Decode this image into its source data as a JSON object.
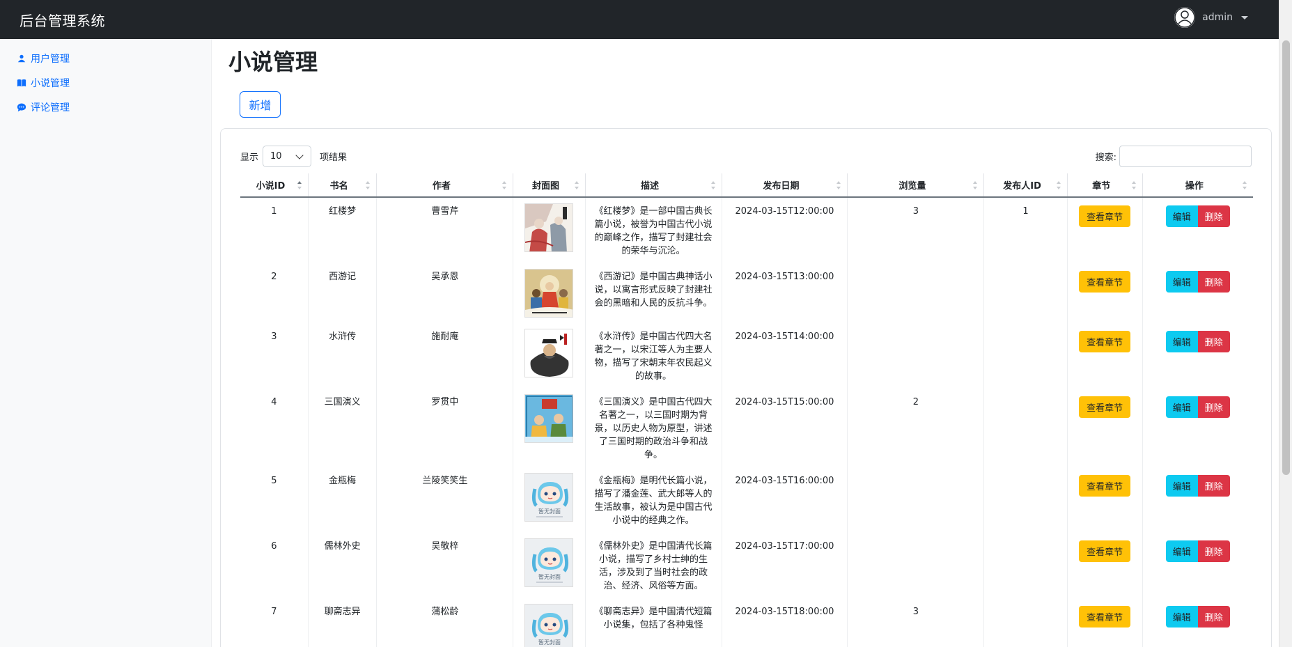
{
  "app": {
    "title": "后台管理系统",
    "user": "admin"
  },
  "sidebar": {
    "items": [
      {
        "label": "用户管理",
        "icon": "user-icon"
      },
      {
        "label": "小说管理",
        "icon": "book-icon"
      },
      {
        "label": "评论管理",
        "icon": "comment-icon"
      }
    ]
  },
  "page": {
    "title": "小说管理",
    "add_label": "新增"
  },
  "table": {
    "show_label": "显示",
    "length_value": "10",
    "results_label": "项结果",
    "search_label": "搜索:",
    "search_value": "",
    "columns": [
      "小说ID",
      "书名",
      "作者",
      "封面图",
      "描述",
      "发布日期",
      "浏览量",
      "发布人ID",
      "章节",
      "操作"
    ],
    "chapter_button": "查看章节",
    "edit_button": "编辑",
    "delete_button": "删除",
    "rows": [
      {
        "id": "1",
        "name": "红楼梦",
        "author": "曹雪芹",
        "cover": "cover-hongloumeng",
        "desc": "《红楼梦》是一部中国古典长篇小说，被誉为中国古代小说的巅峰之作，描写了封建社会的荣华与沉沦。",
        "date": "2024-03-15T12:00:00",
        "views": "3",
        "publisher": "1"
      },
      {
        "id": "2",
        "name": "西游记",
        "author": "吴承恩",
        "cover": "cover-xiyouji",
        "desc": "《西游记》是中国古典神话小说，以寓言形式反映了封建社会的黑暗和人民的反抗斗争。",
        "date": "2024-03-15T13:00:00",
        "views": "",
        "publisher": ""
      },
      {
        "id": "3",
        "name": "水浒传",
        "author": "施耐庵",
        "cover": "cover-shuihuzhuan",
        "desc": "《水浒传》是中国古代四大名著之一，以宋江等人为主要人物，描写了宋朝末年农民起义的故事。",
        "date": "2024-03-15T14:00:00",
        "views": "",
        "publisher": ""
      },
      {
        "id": "4",
        "name": "三国演义",
        "author": "罗贯中",
        "cover": "cover-sanguo",
        "desc": "《三国演义》是中国古代四大名著之一，以三国时期为背景，以历史人物为原型，讲述了三国时期的政治斗争和战争。",
        "date": "2024-03-15T15:00:00",
        "views": "2",
        "publisher": ""
      },
      {
        "id": "5",
        "name": "金瓶梅",
        "author": "兰陵笑笑生",
        "cover": "cover-none",
        "desc": "《金瓶梅》是明代长篇小说，描写了潘金莲、武大郎等人的生活故事，被认为是中国古代小说中的经典之作。",
        "date": "2024-03-15T16:00:00",
        "views": "",
        "publisher": ""
      },
      {
        "id": "6",
        "name": "儒林外史",
        "author": "吴敬梓",
        "cover": "cover-none",
        "desc": "《儒林外史》是中国清代长篇小说，描写了乡村士绅的生活，涉及到了当时社会的政治、经济、风俗等方面。",
        "date": "2024-03-15T17:00:00",
        "views": "",
        "publisher": ""
      },
      {
        "id": "7",
        "name": "聊斋志异",
        "author": "蒲松龄",
        "cover": "cover-none",
        "desc": "《聊斋志异》是中国清代短篇小说集，包括了各种鬼怪",
        "date": "2024-03-15T18:00:00",
        "views": "3",
        "publisher": ""
      }
    ],
    "no_cover_text": "暂无封面"
  }
}
